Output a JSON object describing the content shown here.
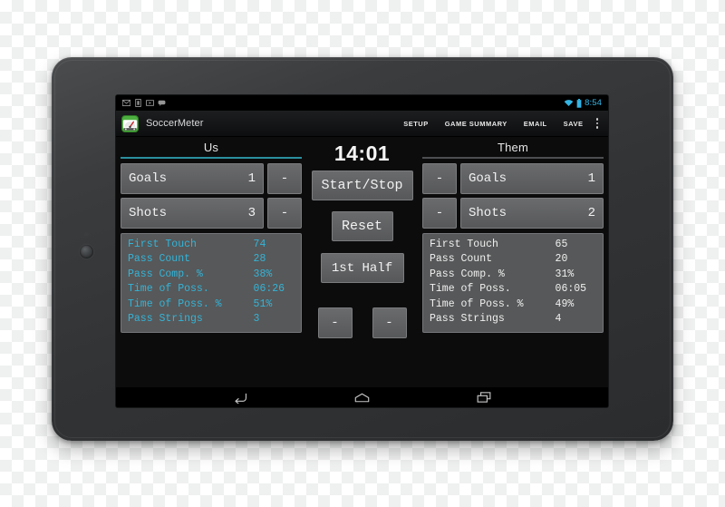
{
  "device": {
    "type": "android-tablet"
  },
  "status_bar": {
    "clock": "8:54",
    "notification_icons": [
      "email-icon",
      "sim-card-icon",
      "play-store-icon",
      "chat-icon"
    ],
    "right_icons": [
      "wifi-icon",
      "battery-icon"
    ],
    "accent_color": "#33b5e5"
  },
  "action_bar": {
    "app_name": "SoccerMeter",
    "logo_icon": "soccermeter-gauge-icon",
    "items": [
      {
        "label": "SETUP"
      },
      {
        "label": "GAME SUMMARY"
      },
      {
        "label": "EMAIL"
      },
      {
        "label": "SAVE"
      }
    ],
    "overflow_icon": "overflow-menu-icon"
  },
  "center": {
    "timer": "14:01",
    "start_stop_label": "Start/Stop",
    "reset_label": "Reset",
    "half_label": "1st Half",
    "minus_label": "-"
  },
  "teams": {
    "us": {
      "name": "Us",
      "active": true,
      "underline_color": "#2a8f9e",
      "text_color": "#33b4d8",
      "counters": [
        {
          "label": "Goals",
          "value": "1",
          "minus_label": "-"
        },
        {
          "label": "Shots",
          "value": "3",
          "minus_label": "-"
        }
      ],
      "stats": [
        {
          "label": "First Touch",
          "value": "74"
        },
        {
          "label": "Pass Count",
          "value": "28"
        },
        {
          "label": "Pass Comp. %",
          "value": "38%"
        },
        {
          "label": "Time of Poss.",
          "value": "06:26"
        },
        {
          "label": "Time of Poss. %",
          "value": "51%"
        },
        {
          "label": "Pass Strings",
          "value": "3"
        }
      ]
    },
    "them": {
      "name": "Them",
      "active": false,
      "underline_color": "#4d4e50",
      "text_color": "#f0f0f0",
      "counters": [
        {
          "label": "Goals",
          "value": "1",
          "minus_label": "-"
        },
        {
          "label": "Shots",
          "value": "2",
          "minus_label": "-"
        }
      ],
      "stats": [
        {
          "label": "First Touch",
          "value": "65"
        },
        {
          "label": "Pass Count",
          "value": "20"
        },
        {
          "label": "Pass Comp. %",
          "value": "31%"
        },
        {
          "label": "Time of Poss.",
          "value": "06:05"
        },
        {
          "label": "Time of Poss. %",
          "value": "49%"
        },
        {
          "label": "Pass Strings",
          "value": "4"
        }
      ]
    }
  },
  "nav_bar": {
    "buttons": [
      {
        "icon": "back-icon"
      },
      {
        "icon": "home-icon"
      },
      {
        "icon": "recents-icon"
      }
    ]
  }
}
